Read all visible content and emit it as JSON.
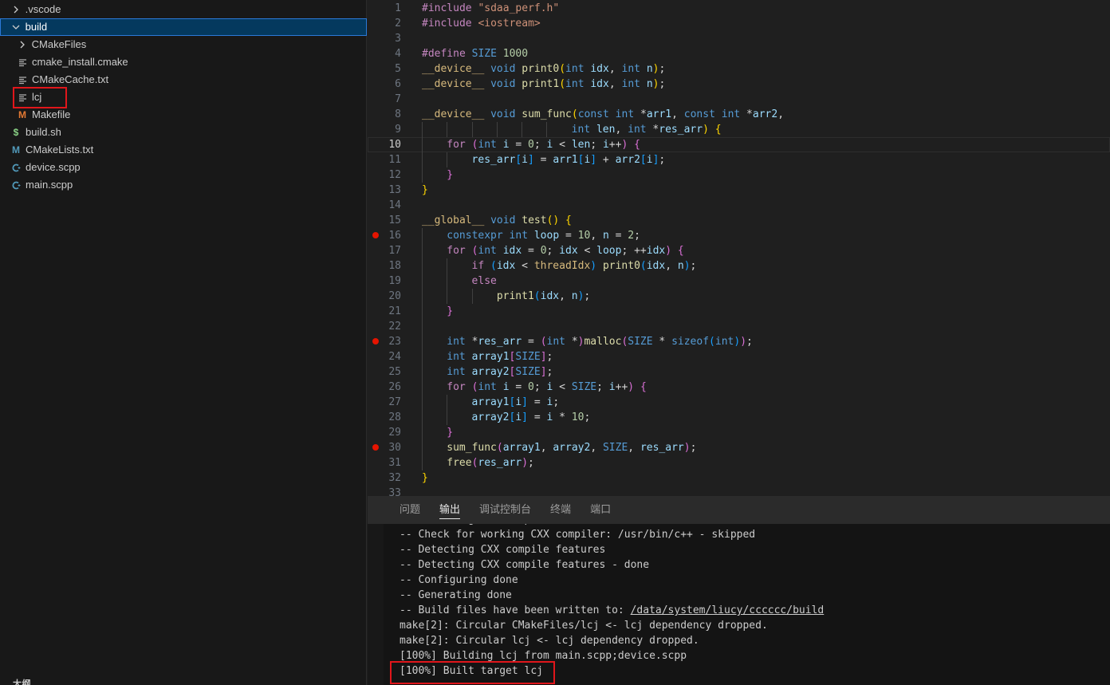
{
  "explorer": {
    "items": [
      {
        "label": ".vscode",
        "type": "folder",
        "expanded": false,
        "depth": 0
      },
      {
        "label": "build",
        "type": "folder",
        "expanded": true,
        "depth": 0,
        "selected": true
      },
      {
        "label": "CMakeFiles",
        "type": "folder",
        "expanded": false,
        "depth": 1
      },
      {
        "label": "cmake_install.cmake",
        "type": "file",
        "icon": "lines-icon",
        "depth": 1
      },
      {
        "label": "CMakeCache.txt",
        "type": "file",
        "icon": "lines-icon",
        "depth": 1
      },
      {
        "label": "lcj",
        "type": "file",
        "icon": "lines-icon",
        "depth": 1,
        "highlighted": true
      },
      {
        "label": "Makefile",
        "type": "file",
        "icon": "makefile-icon",
        "depth": 1
      },
      {
        "label": "build.sh",
        "type": "file",
        "icon": "shell-icon",
        "depth": 0
      },
      {
        "label": "CMakeLists.txt",
        "type": "file",
        "icon": "cmake-icon",
        "depth": 0
      },
      {
        "label": "device.scpp",
        "type": "file",
        "icon": "cpp-icon",
        "depth": 0
      },
      {
        "label": "main.scpp",
        "type": "file",
        "icon": "cpp-icon",
        "depth": 0
      }
    ],
    "outline_label": "大纲"
  },
  "editor": {
    "current_line": 10,
    "breakpoints": [
      16,
      23,
      30
    ],
    "lines": [
      {
        "n": "1",
        "indent": 0,
        "t": [
          [
            "#include ",
            "k-pre"
          ],
          [
            "\"sdaa_perf.h\"",
            "k-str"
          ]
        ]
      },
      {
        "n": "2",
        "indent": 0,
        "t": [
          [
            "#include ",
            "k-pre"
          ],
          [
            "<iostream>",
            "k-str"
          ]
        ]
      },
      {
        "n": "3",
        "indent": 0,
        "t": []
      },
      {
        "n": "4",
        "indent": 0,
        "t": [
          [
            "#define ",
            "k-pre"
          ],
          [
            "SIZE",
            "k-mac"
          ],
          [
            " "
          ],
          [
            "1000",
            "k-num"
          ]
        ]
      },
      {
        "n": "5",
        "indent": 0,
        "t": [
          [
            "__device__",
            "k-qual"
          ],
          [
            " "
          ],
          [
            "void",
            "k-kw"
          ],
          [
            " "
          ],
          [
            "print0",
            "k-fn"
          ],
          [
            "(",
            "k-b1"
          ],
          [
            "int",
            "k-kw"
          ],
          [
            " "
          ],
          [
            "idx",
            "k-var"
          ],
          [
            ", "
          ],
          [
            "int",
            "k-kw"
          ],
          [
            " "
          ],
          [
            "n",
            "k-var"
          ],
          [
            ")",
            "k-b1"
          ],
          [
            ";"
          ]
        ]
      },
      {
        "n": "6",
        "indent": 0,
        "t": [
          [
            "__device__",
            "k-qual"
          ],
          [
            " "
          ],
          [
            "void",
            "k-kw"
          ],
          [
            " "
          ],
          [
            "print1",
            "k-fn"
          ],
          [
            "(",
            "k-b1"
          ],
          [
            "int",
            "k-kw"
          ],
          [
            " "
          ],
          [
            "idx",
            "k-var"
          ],
          [
            ", "
          ],
          [
            "int",
            "k-kw"
          ],
          [
            " "
          ],
          [
            "n",
            "k-var"
          ],
          [
            ")",
            "k-b1"
          ],
          [
            ";"
          ]
        ]
      },
      {
        "n": "7",
        "indent": 0,
        "t": []
      },
      {
        "n": "8",
        "indent": 0,
        "t": [
          [
            "__device__",
            "k-qual"
          ],
          [
            " "
          ],
          [
            "void",
            "k-kw"
          ],
          [
            " "
          ],
          [
            "sum_func",
            "k-fn"
          ],
          [
            "(",
            "k-b1"
          ],
          [
            "const",
            "k-kw"
          ],
          [
            " "
          ],
          [
            "int",
            "k-kw"
          ],
          [
            " *"
          ],
          [
            "arr1",
            "k-var"
          ],
          [
            ", "
          ],
          [
            "const",
            "k-kw"
          ],
          [
            " "
          ],
          [
            "int",
            "k-kw"
          ],
          [
            " *"
          ],
          [
            "arr2",
            "k-var"
          ],
          [
            ","
          ]
        ]
      },
      {
        "n": "9",
        "indent": 6,
        "t": [
          [
            "int",
            "k-kw"
          ],
          [
            " "
          ],
          [
            "len",
            "k-var"
          ],
          [
            ", "
          ],
          [
            "int",
            "k-kw"
          ],
          [
            " *"
          ],
          [
            "res_arr",
            "k-var"
          ],
          [
            ")",
            "k-b1"
          ],
          [
            " "
          ],
          [
            "{",
            "k-b1"
          ]
        ]
      },
      {
        "n": "10",
        "indent": 1,
        "t": [
          [
            "for",
            "k-ctl"
          ],
          [
            " "
          ],
          [
            "(",
            "k-b2"
          ],
          [
            "int",
            "k-kw"
          ],
          [
            " "
          ],
          [
            "i",
            "k-var"
          ],
          [
            " = "
          ],
          [
            "0",
            "k-num"
          ],
          [
            "; "
          ],
          [
            "i",
            "k-var"
          ],
          [
            " < "
          ],
          [
            "len",
            "k-var"
          ],
          [
            "; "
          ],
          [
            "i",
            "k-var"
          ],
          [
            "++"
          ],
          [
            ")",
            "k-b2"
          ],
          [
            " "
          ],
          [
            "{",
            "k-b2"
          ]
        ]
      },
      {
        "n": "11",
        "indent": 2,
        "t": [
          [
            "res_arr",
            "k-var"
          ],
          [
            "[",
            "k-b3"
          ],
          [
            "i",
            "k-var"
          ],
          [
            "]",
            "k-b3"
          ],
          [
            " = "
          ],
          [
            "arr1",
            "k-var"
          ],
          [
            "[",
            "k-b3"
          ],
          [
            "i",
            "k-var"
          ],
          [
            "]",
            "k-b3"
          ],
          [
            " + "
          ],
          [
            "arr2",
            "k-var"
          ],
          [
            "[",
            "k-b3"
          ],
          [
            "i",
            "k-var"
          ],
          [
            "]",
            "k-b3"
          ],
          [
            ";"
          ]
        ]
      },
      {
        "n": "12",
        "indent": 1,
        "t": [
          [
            "}",
            "k-b2"
          ]
        ]
      },
      {
        "n": "13",
        "indent": 0,
        "t": [
          [
            "}",
            "k-b1"
          ]
        ]
      },
      {
        "n": "14",
        "indent": 0,
        "t": []
      },
      {
        "n": "15",
        "indent": 0,
        "t": [
          [
            "__global__",
            "k-qual"
          ],
          [
            " "
          ],
          [
            "void",
            "k-kw"
          ],
          [
            " "
          ],
          [
            "test",
            "k-fn"
          ],
          [
            "()",
            "k-b1"
          ],
          [
            " "
          ],
          [
            "{",
            "k-b1"
          ]
        ]
      },
      {
        "n": "16",
        "indent": 1,
        "t": [
          [
            "constexpr",
            "k-kw"
          ],
          [
            " "
          ],
          [
            "int",
            "k-kw"
          ],
          [
            " "
          ],
          [
            "loop",
            "k-var"
          ],
          [
            " = "
          ],
          [
            "10",
            "k-num"
          ],
          [
            ", "
          ],
          [
            "n",
            "k-var"
          ],
          [
            " = "
          ],
          [
            "2",
            "k-num"
          ],
          [
            ";"
          ]
        ]
      },
      {
        "n": "17",
        "indent": 1,
        "t": [
          [
            "for",
            "k-ctl"
          ],
          [
            " "
          ],
          [
            "(",
            "k-b2"
          ],
          [
            "int",
            "k-kw"
          ],
          [
            " "
          ],
          [
            "idx",
            "k-var"
          ],
          [
            " = "
          ],
          [
            "0",
            "k-num"
          ],
          [
            "; "
          ],
          [
            "idx",
            "k-var"
          ],
          [
            " < "
          ],
          [
            "loop",
            "k-var"
          ],
          [
            "; ++"
          ],
          [
            "idx",
            "k-var"
          ],
          [
            ")",
            "k-b2"
          ],
          [
            " "
          ],
          [
            "{",
            "k-b2"
          ]
        ]
      },
      {
        "n": "18",
        "indent": 2,
        "t": [
          [
            "if",
            "k-ctl"
          ],
          [
            " "
          ],
          [
            "(",
            "k-b3"
          ],
          [
            "idx",
            "k-var"
          ],
          [
            " < "
          ],
          [
            "threadIdx",
            "k-thr"
          ],
          [
            ")",
            "k-b3"
          ],
          [
            " "
          ],
          [
            "print0",
            "k-fn"
          ],
          [
            "(",
            "k-b3"
          ],
          [
            "idx",
            "k-var"
          ],
          [
            ", "
          ],
          [
            "n",
            "k-var"
          ],
          [
            ")",
            "k-b3"
          ],
          [
            ";"
          ]
        ]
      },
      {
        "n": "19",
        "indent": 2,
        "t": [
          [
            "else",
            "k-ctl"
          ]
        ]
      },
      {
        "n": "20",
        "indent": 3,
        "t": [
          [
            "print1",
            "k-fn"
          ],
          [
            "(",
            "k-b3"
          ],
          [
            "idx",
            "k-var"
          ],
          [
            ", "
          ],
          [
            "n",
            "k-var"
          ],
          [
            ")",
            "k-b3"
          ],
          [
            ";"
          ]
        ]
      },
      {
        "n": "21",
        "indent": 1,
        "t": [
          [
            "}",
            "k-b2"
          ]
        ]
      },
      {
        "n": "22",
        "indent": 1,
        "t": []
      },
      {
        "n": "23",
        "indent": 1,
        "t": [
          [
            "int",
            "k-kw"
          ],
          [
            " *"
          ],
          [
            "res_arr",
            "k-var"
          ],
          [
            " = "
          ],
          [
            "(",
            "k-b2"
          ],
          [
            "int",
            "k-kw"
          ],
          [
            " *"
          ],
          [
            ")",
            "k-b2"
          ],
          [
            "malloc",
            "k-fn"
          ],
          [
            "(",
            "k-b2"
          ],
          [
            "SIZE",
            "k-mac"
          ],
          [
            " * "
          ],
          [
            "sizeof",
            "k-kw"
          ],
          [
            "(",
            "k-b3"
          ],
          [
            "int",
            "k-kw"
          ],
          [
            ")",
            "k-b3"
          ],
          [
            ")",
            "k-b2"
          ],
          [
            ";"
          ]
        ]
      },
      {
        "n": "24",
        "indent": 1,
        "t": [
          [
            "int",
            "k-kw"
          ],
          [
            " "
          ],
          [
            "array1",
            "k-var"
          ],
          [
            "[",
            "k-b2"
          ],
          [
            "SIZE",
            "k-mac"
          ],
          [
            "]",
            "k-b2"
          ],
          [
            ";"
          ]
        ]
      },
      {
        "n": "25",
        "indent": 1,
        "t": [
          [
            "int",
            "k-kw"
          ],
          [
            " "
          ],
          [
            "array2",
            "k-var"
          ],
          [
            "[",
            "k-b2"
          ],
          [
            "SIZE",
            "k-mac"
          ],
          [
            "]",
            "k-b2"
          ],
          [
            ";"
          ]
        ]
      },
      {
        "n": "26",
        "indent": 1,
        "t": [
          [
            "for",
            "k-ctl"
          ],
          [
            " "
          ],
          [
            "(",
            "k-b2"
          ],
          [
            "int",
            "k-kw"
          ],
          [
            " "
          ],
          [
            "i",
            "k-var"
          ],
          [
            " = "
          ],
          [
            "0",
            "k-num"
          ],
          [
            "; "
          ],
          [
            "i",
            "k-var"
          ],
          [
            " < "
          ],
          [
            "SIZE",
            "k-mac"
          ],
          [
            "; "
          ],
          [
            "i",
            "k-var"
          ],
          [
            "++"
          ],
          [
            ")",
            "k-b2"
          ],
          [
            " "
          ],
          [
            "{",
            "k-b2"
          ]
        ]
      },
      {
        "n": "27",
        "indent": 2,
        "t": [
          [
            "array1",
            "k-var"
          ],
          [
            "[",
            "k-b3"
          ],
          [
            "i",
            "k-var"
          ],
          [
            "]",
            "k-b3"
          ],
          [
            " = "
          ],
          [
            "i",
            "k-var"
          ],
          [
            ";"
          ]
        ]
      },
      {
        "n": "28",
        "indent": 2,
        "t": [
          [
            "array2",
            "k-var"
          ],
          [
            "[",
            "k-b3"
          ],
          [
            "i",
            "k-var"
          ],
          [
            "]",
            "k-b3"
          ],
          [
            " = "
          ],
          [
            "i",
            "k-var"
          ],
          [
            " * "
          ],
          [
            "10",
            "k-num"
          ],
          [
            ";"
          ]
        ]
      },
      {
        "n": "29",
        "indent": 1,
        "t": [
          [
            "}",
            "k-b2"
          ]
        ]
      },
      {
        "n": "30",
        "indent": 1,
        "t": [
          [
            "sum_func",
            "k-fn"
          ],
          [
            "(",
            "k-b2"
          ],
          [
            "array1",
            "k-var"
          ],
          [
            ", "
          ],
          [
            "array2",
            "k-var"
          ],
          [
            ", "
          ],
          [
            "SIZE",
            "k-mac"
          ],
          [
            ", "
          ],
          [
            "res_arr",
            "k-var"
          ],
          [
            ")",
            "k-b2"
          ],
          [
            ";"
          ]
        ]
      },
      {
        "n": "31",
        "indent": 1,
        "t": [
          [
            "free",
            "k-fn"
          ],
          [
            "(",
            "k-b2"
          ],
          [
            "res_arr",
            "k-var"
          ],
          [
            ")",
            "k-b2"
          ],
          [
            ";"
          ]
        ]
      },
      {
        "n": "32",
        "indent": 0,
        "t": [
          [
            "}",
            "k-b1"
          ]
        ]
      },
      {
        "n": "33",
        "indent": 0,
        "t": []
      }
    ]
  },
  "panel": {
    "tabs": [
      {
        "label": "问题",
        "active": false
      },
      {
        "label": "输出",
        "active": true
      },
      {
        "label": "调试控制台",
        "active": false
      },
      {
        "label": "终端",
        "active": false
      },
      {
        "label": "端口",
        "active": false
      }
    ],
    "output_lines": [
      {
        "text": "-- Detecting CXX compiler ABI info - done"
      },
      {
        "text": "-- Check for working CXX compiler: /usr/bin/c++ - skipped"
      },
      {
        "text": "-- Detecting CXX compile features"
      },
      {
        "text": "-- Detecting CXX compile features - done"
      },
      {
        "text": "-- Configuring done"
      },
      {
        "text": "-- Generating done"
      },
      {
        "text": "-- Build files have been written to: ",
        "link": "/data/system/liucy/cccccc/build"
      },
      {
        "text": "make[2]: Circular CMakeFiles/lcj <- lcj dependency dropped."
      },
      {
        "text": "make[2]: Circular lcj <- lcj dependency dropped."
      },
      {
        "text": "[100%] Building lcj from main.scpp;device.scpp"
      },
      {
        "text": "[100%] Built target lcj"
      }
    ]
  }
}
